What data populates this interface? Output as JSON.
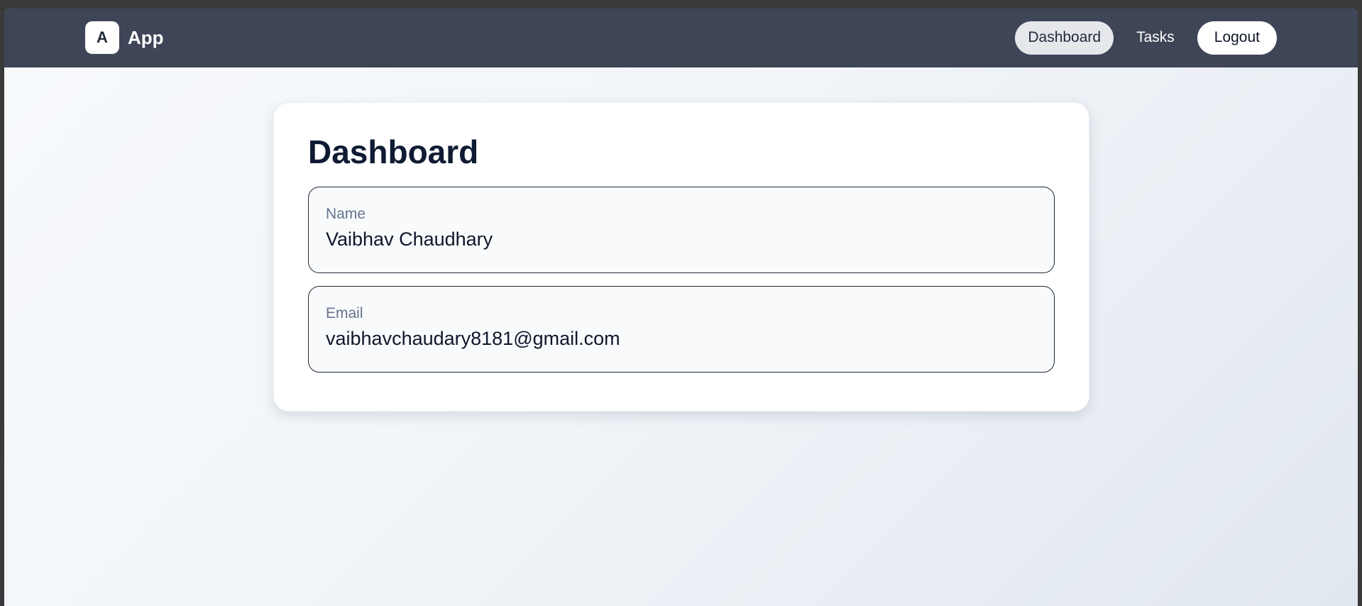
{
  "app": {
    "logo_letter": "A",
    "name": "App"
  },
  "nav": {
    "dashboard": "Dashboard",
    "tasks": "Tasks",
    "logout": "Logout"
  },
  "page": {
    "title": "Dashboard"
  },
  "profile": {
    "name_label": "Name",
    "name_value": "Vaibhav Chaudhary",
    "email_label": "Email",
    "email_value": "vaibhavchaudary8181@gmail.com"
  },
  "colors": {
    "navbar": "#3e4557",
    "card": "#ffffff",
    "title": "#0f1b33",
    "label": "#64748b"
  }
}
